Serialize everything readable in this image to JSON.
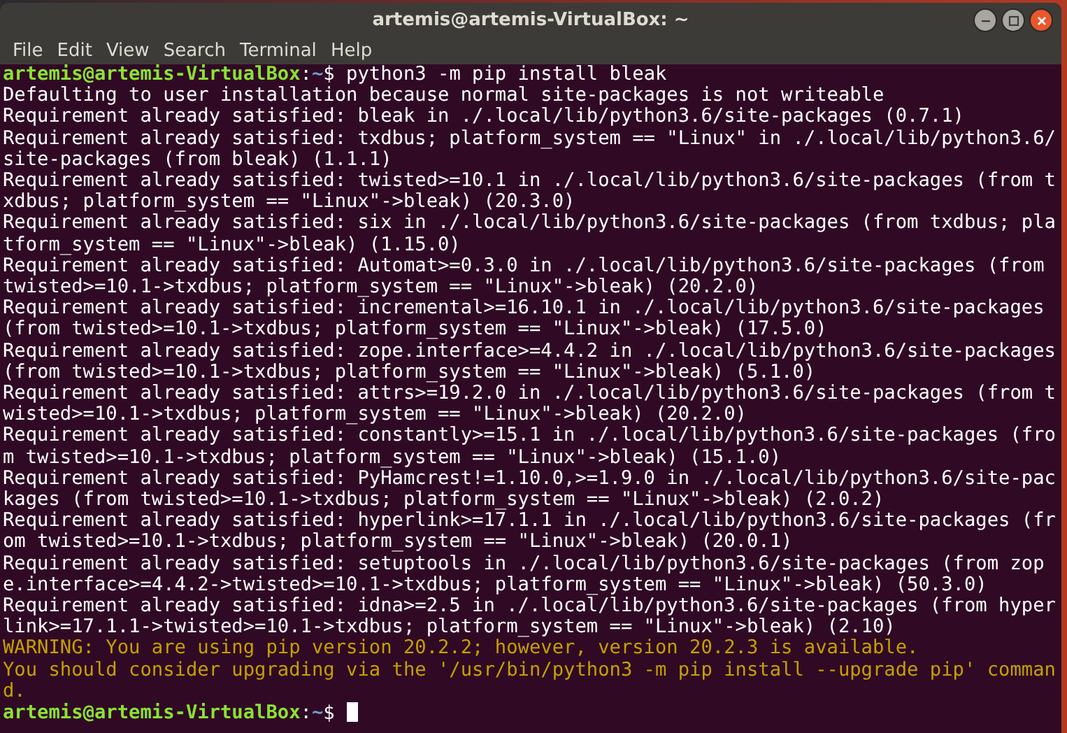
{
  "window": {
    "title": "artemis@artemis-VirtualBox: ~"
  },
  "menu": [
    "File",
    "Edit",
    "View",
    "Search",
    "Terminal",
    "Help"
  ],
  "lines": [
    {
      "kind": "prompt",
      "user_host": "artemis@artemis-VirtualBox",
      "separator": ":",
      "path": "~",
      "symbol": "$",
      "command": "python3 -m pip install bleak",
      "cursor": false
    },
    {
      "kind": "output",
      "text": "Defaulting to user installation because normal site-packages is not writeable"
    },
    {
      "kind": "output",
      "text": "Requirement already satisfied: bleak in ./.local/lib/python3.6/site-packages (0.7.1)"
    },
    {
      "kind": "output",
      "text": "Requirement already satisfied: txdbus; platform_system == \"Linux\" in ./.local/lib/python3.6/site-packages (from bleak) (1.1.1)"
    },
    {
      "kind": "output",
      "text": "Requirement already satisfied: twisted>=10.1 in ./.local/lib/python3.6/site-packages (from txdbus; platform_system == \"Linux\"->bleak) (20.3.0)"
    },
    {
      "kind": "output",
      "text": "Requirement already satisfied: six in ./.local/lib/python3.6/site-packages (from txdbus; platform_system == \"Linux\"->bleak) (1.15.0)"
    },
    {
      "kind": "output",
      "text": "Requirement already satisfied: Automat>=0.3.0 in ./.local/lib/python3.6/site-packages (from twisted>=10.1->txdbus; platform_system == \"Linux\"->bleak) (20.2.0)"
    },
    {
      "kind": "output",
      "text": "Requirement already satisfied: incremental>=16.10.1 in ./.local/lib/python3.6/site-packages (from twisted>=10.1->txdbus; platform_system == \"Linux\"->bleak) (17.5.0)"
    },
    {
      "kind": "output",
      "text": "Requirement already satisfied: zope.interface>=4.4.2 in ./.local/lib/python3.6/site-packages (from twisted>=10.1->txdbus; platform_system == \"Linux\"->bleak) (5.1.0)"
    },
    {
      "kind": "output",
      "text": "Requirement already satisfied: attrs>=19.2.0 in ./.local/lib/python3.6/site-packages (from twisted>=10.1->txdbus; platform_system == \"Linux\"->bleak) (20.2.0)"
    },
    {
      "kind": "output",
      "text": "Requirement already satisfied: constantly>=15.1 in ./.local/lib/python3.6/site-packages (from twisted>=10.1->txdbus; platform_system == \"Linux\"->bleak) (15.1.0)"
    },
    {
      "kind": "output",
      "text": "Requirement already satisfied: PyHamcrest!=1.10.0,>=1.9.0 in ./.local/lib/python3.6/site-packages (from twisted>=10.1->txdbus; platform_system == \"Linux\"->bleak) (2.0.2)"
    },
    {
      "kind": "output",
      "text": "Requirement already satisfied: hyperlink>=17.1.1 in ./.local/lib/python3.6/site-packages (from twisted>=10.1->txdbus; platform_system == \"Linux\"->bleak) (20.0.1)"
    },
    {
      "kind": "output",
      "text": "Requirement already satisfied: setuptools in ./.local/lib/python3.6/site-packages (from zope.interface>=4.4.2->twisted>=10.1->txdbus; platform_system == \"Linux\"->bleak) (50.3.0)"
    },
    {
      "kind": "output",
      "text": "Requirement already satisfied: idna>=2.5 in ./.local/lib/python3.6/site-packages (from hyperlink>=17.1.1->twisted>=10.1->txdbus; platform_system == \"Linux\"->bleak) (2.10)"
    },
    {
      "kind": "warning",
      "text": "WARNING: You are using pip version 20.2.2; however, version 20.2.3 is available."
    },
    {
      "kind": "warning",
      "text": "You should consider upgrading via the '/usr/bin/python3 -m pip install --upgrade pip' command."
    },
    {
      "kind": "prompt",
      "user_host": "artemis@artemis-VirtualBox",
      "separator": ":",
      "path": "~",
      "symbol": "$",
      "cursor": true
    }
  ]
}
